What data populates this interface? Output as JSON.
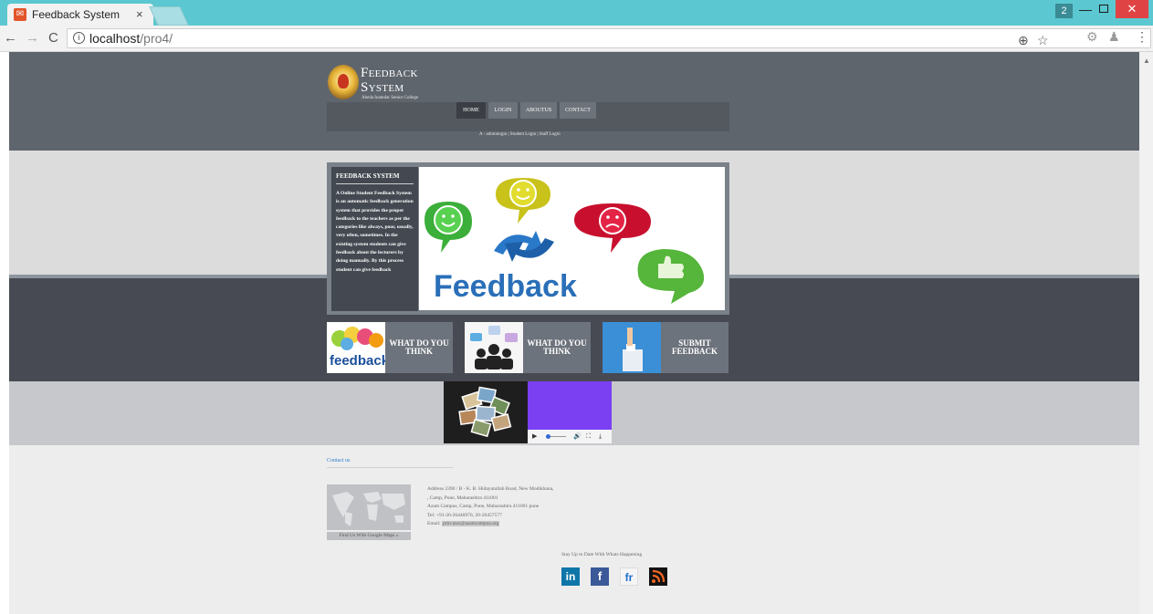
{
  "browser": {
    "tab_title": "Feedback System",
    "tab_close": "×",
    "url_host": "localhost",
    "url_path": "/pro4/",
    "back": "←",
    "forward": "→",
    "reload": "C",
    "window_user": "2",
    "window_minimize": "—",
    "window_close": "✕",
    "zoom_icon": "⊕",
    "star_icon": "☆",
    "menu_icon": "⋮"
  },
  "header": {
    "brand_line1": "Feedback",
    "brand_line2": "System",
    "college": "Abeda Inamdar Senior College"
  },
  "nav": {
    "items": [
      {
        "label": "HOME",
        "active": true
      },
      {
        "label": "LOGIN",
        "active": false
      },
      {
        "label": "ABOUTUS",
        "active": false
      },
      {
        "label": "CONTACT",
        "active": false
      }
    ],
    "login_links": "A - adminlogin | Student Login | Staff Login"
  },
  "hero": {
    "heading": "FEEDBACK SYSTEM",
    "body": "A Online Student Feedback System is an automatic feedback generation system that provides the proper feedback to the teachers as per the categories like always, poor, usually, very often, sometimes. In the existing system students can give feedback about the lecturers by doing manually. By this process student can give feedback",
    "image_word": "Feedback"
  },
  "cards": [
    {
      "label": "WHAT DO YOU THINK",
      "image_text": "feedback"
    },
    {
      "label": "WHAT DO YOU THINK",
      "image_text": ""
    },
    {
      "label": "SUBMIT FEEDBACK",
      "image_text": ""
    }
  ],
  "video_controls": {
    "play": "▶",
    "volume": "🔊",
    "fullscreen": "⛶",
    "download": "⤓"
  },
  "footer": {
    "contact_title": "Contact us",
    "map_caption": "Find Us With Google Maps »",
    "address_lines": [
      "Address 2390 / B - K. B. Hidayatullah Road, New Modikhana,",
      ", Camp, Pune, Maharashtra 411001",
      "Azam Campus, Camp, Pune, Maharashtra 411001 pune",
      "Tel: +91-20-26446970, 20-26457577"
    ],
    "email_label": "Email:",
    "email_value": "prin-aisc@azamcampus.org",
    "stay_text": "Stay Up to Date With Whats Happening",
    "social": [
      {
        "label": "in",
        "color": "#0e76a8"
      },
      {
        "label": "f",
        "color": "#3b5998"
      },
      {
        "label": "fr",
        "color": "#f5f5f5"
      },
      {
        "label": "rss",
        "color": "#111111"
      }
    ]
  }
}
